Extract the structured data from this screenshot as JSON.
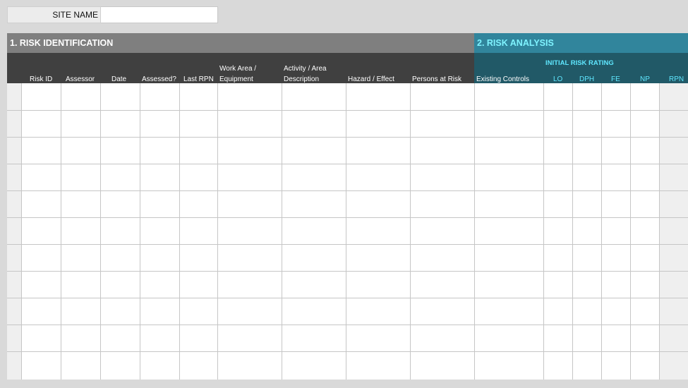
{
  "site": {
    "label": "SITE NAME",
    "value": ""
  },
  "sections": {
    "identification": "1. RISK IDENTIFICATION",
    "analysis": "2. RISK ANALYSIS",
    "initial_risk_rating": "INITIAL RISK RATING"
  },
  "columns": {
    "risk_id": "Risk ID",
    "assessor": "Assessor",
    "date": "Date",
    "assessed": "Assessed?",
    "last_rpn": "Last RPN",
    "work_area_1": "Work Area /",
    "work_area_2": "Equipment",
    "activity_1": "Activity / Area",
    "activity_2": "Description",
    "hazard": "Hazard / Effect",
    "persons": "Persons at Risk",
    "controls": "Existing Controls",
    "lo": "LO",
    "dph": "DPH",
    "fe": "FE",
    "np": "NP",
    "rpn": "RPN"
  },
  "rows": 11,
  "colors": {
    "identification_band": "#7f7f7f",
    "analysis_band": "#31859c",
    "header_dark": "#404040",
    "header_teal": "#215967",
    "cyan_text": "#5fe7ff"
  }
}
